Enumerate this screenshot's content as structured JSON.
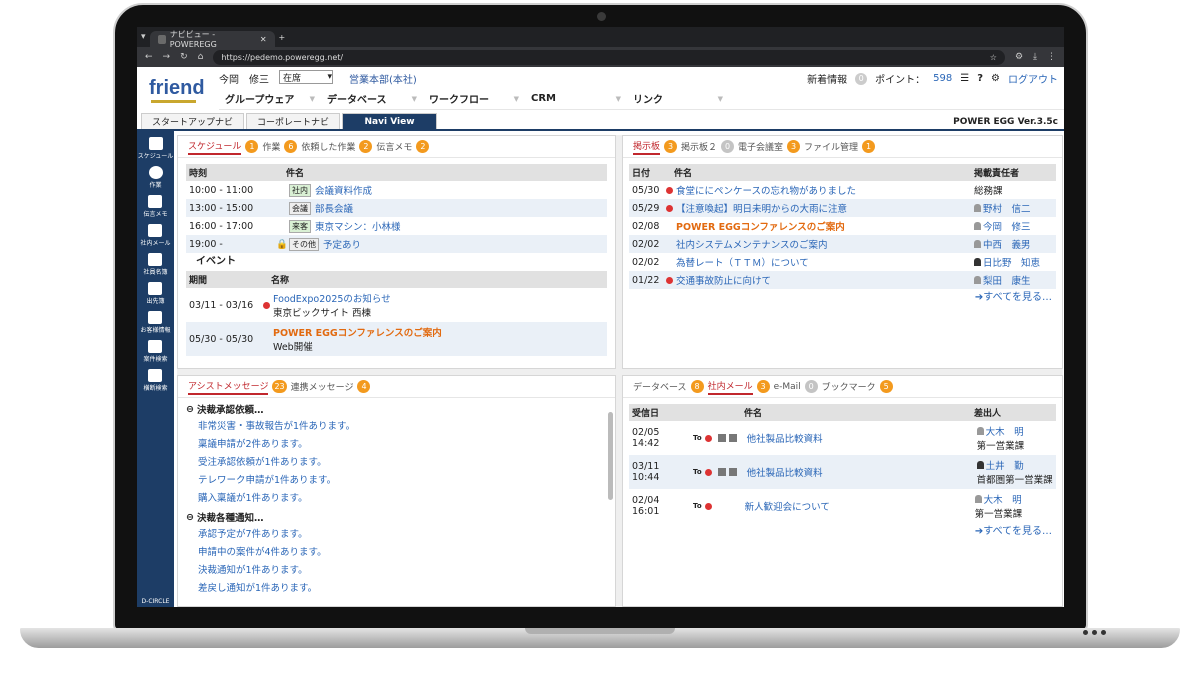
{
  "browser": {
    "tab_title": "ナビビュー - POWEREGG",
    "url": "https://pedemo.poweregg.net/"
  },
  "header": {
    "logo": "friend",
    "user": "今岡　修三",
    "status": "在席",
    "dept": "営業本部(本社)",
    "new_info": "新着情報",
    "new_info_count": "0",
    "points_label": "ポイント：",
    "points": "598",
    "logout": "ログアウト",
    "help": "?"
  },
  "menu": [
    "グループウェア",
    "データベース",
    "ワークフロー",
    "CRM",
    "リンク"
  ],
  "navtabs": [
    "スタートアップナビ",
    "コーポレートナビ",
    "Navi View"
  ],
  "version": "POWER EGG Ver.3.5c",
  "sidebar": [
    "スケジュール",
    "作業",
    "伝言メモ",
    "社内メール",
    "社員名簿",
    "出先簿",
    "お客様情報",
    "案件検索",
    "横断検索"
  ],
  "sidebar_brand": "D-CIRCLE",
  "schedule": {
    "tabs": [
      {
        "label": "スケジュール",
        "count": "1"
      },
      {
        "label": "作業",
        "count": "6"
      },
      {
        "label": "依頼した作業",
        "count": "2"
      },
      {
        "label": "伝言メモ",
        "count": "2"
      }
    ],
    "col_time": "時刻",
    "col_subject": "件名",
    "rows": [
      {
        "time": "10:00 - 11:00",
        "cat": "社内",
        "subject": "会議資料作成"
      },
      {
        "time": "13:00 - 15:00",
        "cat": "会議",
        "subject": "部長会議"
      },
      {
        "time": "16:00 - 17:00",
        "cat": "来客",
        "subject": "東京マシン：小林様"
      },
      {
        "time": "19:00 -",
        "cat": "その他",
        "subject": "予定あり"
      }
    ],
    "event_label": "イベント",
    "col_period": "期間",
    "col_name": "名称",
    "events": [
      {
        "period": "03/11 - 03/16",
        "name": "FoodExpo2025のお知らせ",
        "place": "東京ビックサイト 西棟"
      },
      {
        "period": "05/30 - 05/30",
        "name": "POWER EGGコンファレンスのご案内",
        "place": "Web開催"
      }
    ]
  },
  "board": {
    "tabs": [
      {
        "label": "掲示板",
        "count": "3"
      },
      {
        "label": "掲示板２",
        "count": "0"
      },
      {
        "label": "電子会議室",
        "count": "3"
      },
      {
        "label": "ファイル管理",
        "count": "1"
      }
    ],
    "col_date": "日付",
    "col_subject": "件名",
    "col_owner": "掲載責任者",
    "rows": [
      {
        "date": "05/30",
        "subject": "食堂ににペンケースの忘れ物がありました",
        "owner": "総務課"
      },
      {
        "date": "05/29",
        "subject": "【注意喚起】明日未明からの大雨に注意",
        "owner": "野村　信二"
      },
      {
        "date": "02/08",
        "subject": "POWER EGGコンファレンスのご案内",
        "owner": "今岡　修三"
      },
      {
        "date": "02/02",
        "subject": "社内システムメンテナンスのご案内",
        "owner": "中西　義男"
      },
      {
        "date": "02/02",
        "subject": "為替レート（ＴＴＭ）について",
        "owner": "日比野　知恵"
      },
      {
        "date": "01/22",
        "subject": "交通事故防止に向けて",
        "owner": "梨田　康生"
      }
    ],
    "see_all": "➔すべてを見る…"
  },
  "assist": {
    "tabs": [
      {
        "label": "アシストメッセージ",
        "count": "23"
      },
      {
        "label": "連携メッセージ",
        "count": "4"
      }
    ],
    "groups": [
      {
        "title": "決裁承認依頼…",
        "items": [
          "非常災害・事故報告が1件あります。",
          "稟議申請が2件あります。",
          "受注承認依頼が1件あります。",
          "テレワーク申請が1件あります。",
          "購入稟議が1件あります。"
        ]
      },
      {
        "title": "決裁各種通知…",
        "items": [
          "承認予定が7件あります。",
          "申請中の案件が4件あります。",
          "決裁通知が1件あります。",
          "差戻し通知が1件あります。"
        ]
      }
    ]
  },
  "mail": {
    "tabs": [
      {
        "label": "データベース",
        "count": "8"
      },
      {
        "label": "社内メール",
        "count": "3"
      },
      {
        "label": "e-Mail",
        "count": "0"
      },
      {
        "label": "ブックマーク",
        "count": "5"
      }
    ],
    "col_recv": "受信日",
    "col_subject": "件名",
    "col_from": "差出人",
    "rows": [
      {
        "date": "02/05 14:42",
        "to": "To",
        "subject": "他社製品比較資料",
        "from": "大木　明",
        "dept": "第一営業課"
      },
      {
        "date": "03/11 10:44",
        "to": "To",
        "subject": "他社製品比較資料",
        "from": "土井　勤",
        "dept": "首都圏第一営業課"
      },
      {
        "date": "02/04 16:01",
        "to": "To",
        "subject": "新人歓迎会について",
        "from": "大木　明",
        "dept": "第一営業課"
      }
    ],
    "see_all": "➔すべてを見る…"
  }
}
